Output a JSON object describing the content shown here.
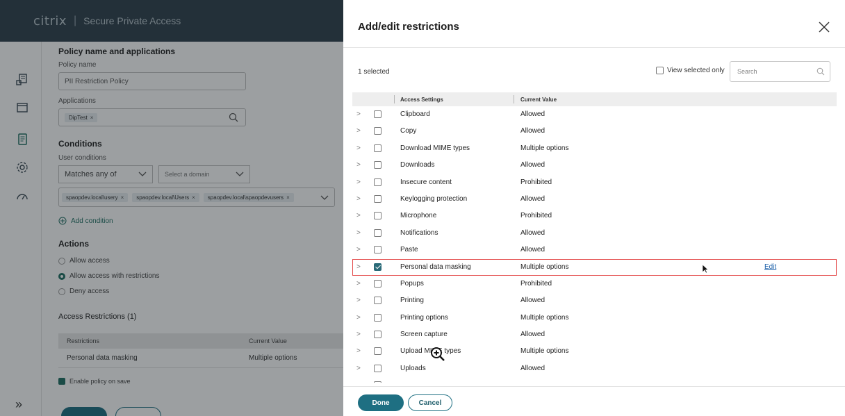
{
  "app": {
    "brand": "citrix",
    "product": "Secure Private Access"
  },
  "background_form": {
    "section_policy": "Policy name and applications",
    "policy_name_label": "Policy name",
    "policy_name_value": "PII Restriction Policy",
    "applications_label": "Applications",
    "application_chip": "DipTest",
    "section_conditions": "Conditions",
    "user_conditions_label": "User conditions",
    "match_select": "Matches any of",
    "domain_select": "Select a domain",
    "user_chips": [
      "spaopdev.local\\usery",
      "spaopdev.local\\Users",
      "spaopdev.local\\spaopdevusers"
    ],
    "add_condition": "Add condition",
    "section_actions": "Actions",
    "actions": [
      {
        "label": "Allow access",
        "selected": false
      },
      {
        "label": "Allow access with restrictions",
        "selected": true
      },
      {
        "label": "Deny access",
        "selected": false
      }
    ],
    "section_restrictions": "Access Restrictions (1)",
    "restrictions_header": [
      "Restrictions",
      "Current Value"
    ],
    "restrictions_row": [
      "Personal data masking",
      "Multiple options"
    ],
    "enable_on_save": "Enable policy on save"
  },
  "modal": {
    "title": "Add/edit restrictions",
    "selected_count": "1 selected",
    "view_selected_only": "View selected only",
    "search_placeholder": "Search",
    "columns": [
      "Access Settings",
      "Current Value"
    ],
    "rows": [
      {
        "name": "Clipboard",
        "value": "Allowed",
        "checked": false
      },
      {
        "name": "Copy",
        "value": "Allowed",
        "checked": false
      },
      {
        "name": "Download MIME types",
        "value": "Multiple options",
        "checked": false
      },
      {
        "name": "Downloads",
        "value": "Allowed",
        "checked": false
      },
      {
        "name": "Insecure content",
        "value": "Prohibited",
        "checked": false
      },
      {
        "name": "Keylogging protection",
        "value": "Allowed",
        "checked": false
      },
      {
        "name": "Microphone",
        "value": "Prohibited",
        "checked": false
      },
      {
        "name": "Notifications",
        "value": "Allowed",
        "checked": false
      },
      {
        "name": "Paste",
        "value": "Allowed",
        "checked": false
      },
      {
        "name": "Personal data masking",
        "value": "Multiple options",
        "checked": true,
        "edit": "Edit"
      },
      {
        "name": "Popups",
        "value": "Prohibited",
        "checked": false
      },
      {
        "name": "Printing",
        "value": "Allowed",
        "checked": false
      },
      {
        "name": "Printing options",
        "value": "Multiple options",
        "checked": false
      },
      {
        "name": "Screen capture",
        "value": "Allowed",
        "checked": false
      },
      {
        "name": "Upload MIME types",
        "value": "Multiple options",
        "checked": false
      },
      {
        "name": "Uploads",
        "value": "Allowed",
        "checked": false
      }
    ],
    "done_label": "Done",
    "cancel_label": "Cancel"
  },
  "colors": {
    "accent": "#1e6f82",
    "highlight_border": "#e44a4a",
    "topbar": "#30404c",
    "link": "#1a5ea8"
  }
}
